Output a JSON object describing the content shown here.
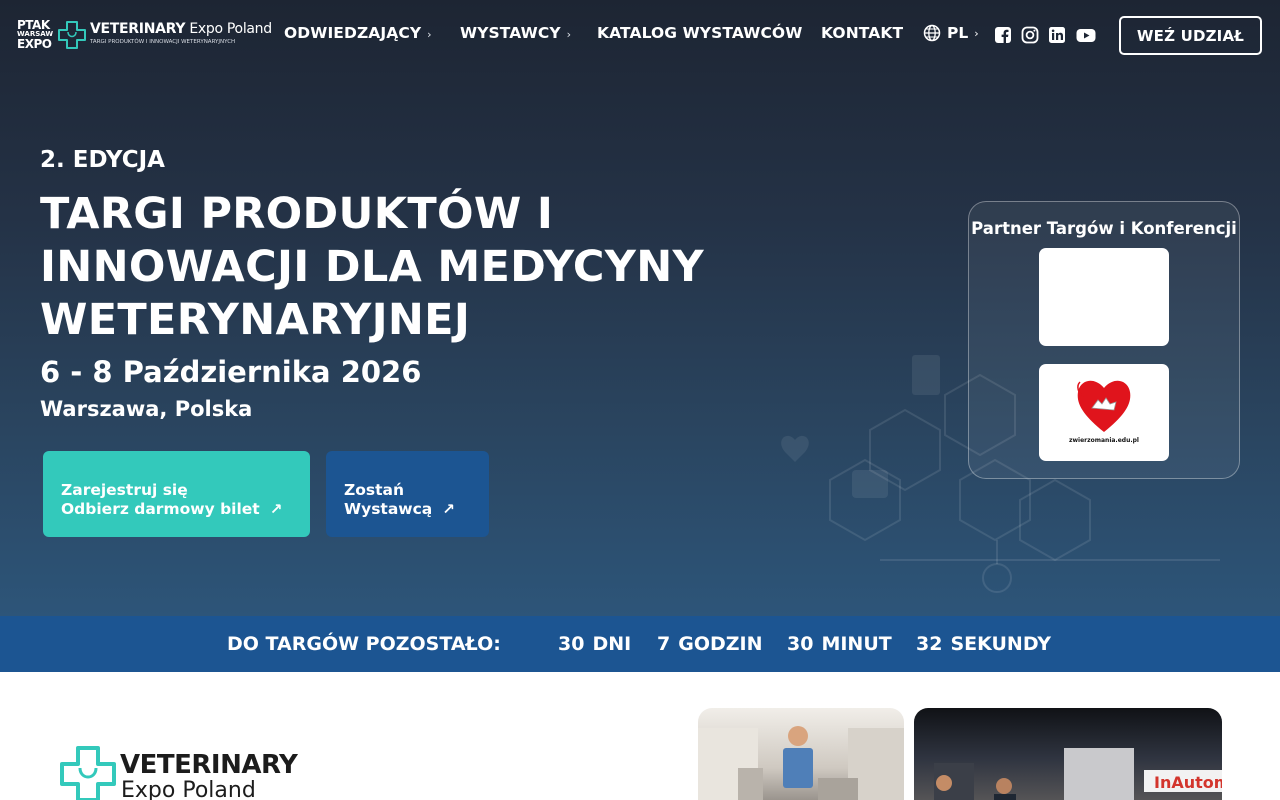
{
  "nav": {
    "ptak_logo": {
      "line1": "PTAK",
      "line2": "WARSAW",
      "line3": "EXPO"
    },
    "brand_logo": {
      "name_bold": "VETERINARY",
      "name_light": "Expo Poland",
      "tagline": "TARGI PRODUKTÓW I INNOWACJI WETERYNARYJNYCH"
    },
    "items": [
      {
        "label": "ODWIEDZAJĄCY",
        "chevron": "›"
      },
      {
        "label": "WYSTAWCY",
        "chevron": "›"
      },
      {
        "label": "KATALOG WYSTAWCÓW"
      },
      {
        "label": "KONTAKT"
      }
    ],
    "language": {
      "label": "PL",
      "icon": "globe-icon",
      "chevron": "›"
    },
    "social": [
      "facebook-icon",
      "instagram-icon",
      "linkedin-icon",
      "youtube-icon"
    ],
    "cta_label": "WEŹ UDZIAŁ"
  },
  "hero": {
    "edition": "2. EDYCJA",
    "headline": "TARGI PRODUKTÓW I INNOWACJI DLA MEDYCYNY WETERYNARYJNEJ",
    "dates": "6 - 8 Października 2026",
    "location": "Warszawa, Polska",
    "register_button": {
      "line1": "Zarejestruj się",
      "line2": "Odbierz darmowy bilet",
      "icon": "arrow-up-right-icon"
    },
    "exhibitor_button": {
      "line1": "Zostań",
      "line2": "Wystawcą",
      "icon": "arrow-up-right-icon"
    },
    "partner": {
      "title": "Partner Targów i Konferencji",
      "logo2_caption": "zwierzomania.edu.pl"
    }
  },
  "countdown": {
    "label": "DO TARGÓW POZOSTAŁO:",
    "days": {
      "value": "30",
      "unit": "DNI"
    },
    "hours": {
      "value": "7",
      "unit": "GODZIN"
    },
    "minutes": {
      "value": "30",
      "unit": "MINUT"
    },
    "seconds": {
      "value": "32",
      "unit": "SEKUNDY"
    }
  },
  "about": {
    "logo_bold": "VETERINARY",
    "logo_light": "Expo Poland"
  },
  "colors": {
    "teal": "#33c9bb",
    "navy": "#1c5592",
    "hero_dark": "#1d2533"
  }
}
